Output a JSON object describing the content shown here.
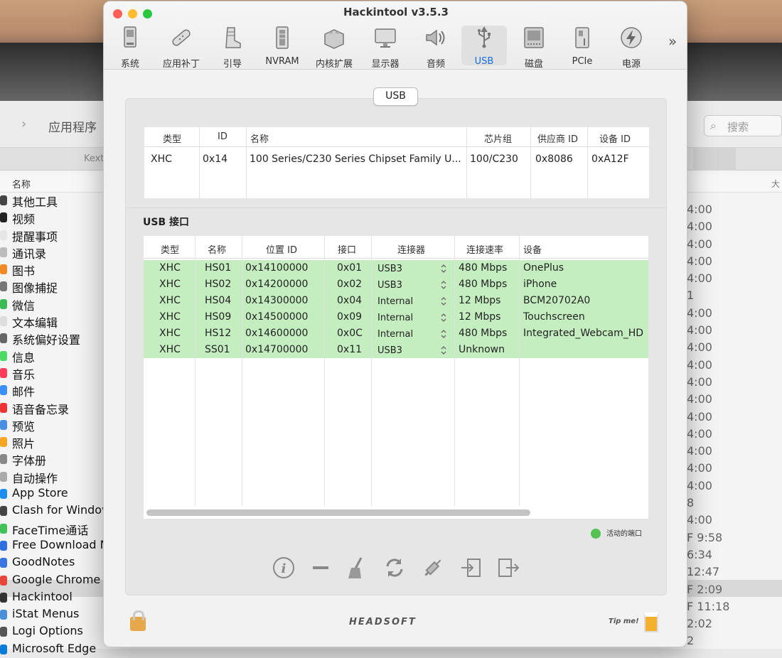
{
  "window": {
    "title": "Hackintool v3.5.3"
  },
  "toolbar": [
    {
      "label": "系统",
      "icon": "computer-icon"
    },
    {
      "label": "应用补丁",
      "icon": "bandage-icon"
    },
    {
      "label": "引导",
      "icon": "boot-icon"
    },
    {
      "label": "NVRAM",
      "icon": "nvram-chip-icon"
    },
    {
      "label": "内核扩展",
      "icon": "lego-brick-icon"
    },
    {
      "label": "显示器",
      "icon": "display-icon"
    },
    {
      "label": "音频",
      "icon": "speaker-icon"
    },
    {
      "label": "USB",
      "icon": "usb-icon"
    },
    {
      "label": "磁盘",
      "icon": "disk-icon"
    },
    {
      "label": "PCIe",
      "icon": "pcie-card-icon"
    },
    {
      "label": "电源",
      "icon": "power-bolt-icon"
    }
  ],
  "toolbar_more": "»",
  "segment": {
    "label": "USB"
  },
  "controller_table": {
    "headers": [
      "类型",
      "ID",
      "名称",
      "芯片组",
      "供应商 ID",
      "设备 ID"
    ],
    "rows": [
      [
        "XHC",
        "0x14",
        "100 Series/C230 Series Chipset Family U...",
        "100/C230",
        "0x8086",
        "0xA12F"
      ]
    ]
  },
  "ports_section": {
    "title": "USB 接口"
  },
  "ports_table": {
    "headers": [
      "类型",
      "名称",
      "位置 ID",
      "接口",
      "连接器",
      "连接速率",
      "设备"
    ],
    "rows": [
      [
        "XHC",
        "HS01",
        "0x14100000",
        "0x01",
        "USB3",
        "480 Mbps",
        "OnePlus"
      ],
      [
        "XHC",
        "HS02",
        "0x14200000",
        "0x02",
        "USB3",
        "480 Mbps",
        "iPhone"
      ],
      [
        "XHC",
        "HS04",
        "0x14300000",
        "0x04",
        "Internal",
        "12 Mbps",
        "BCM20702A0"
      ],
      [
        "XHC",
        "HS09",
        "0x14500000",
        "0x09",
        "Internal",
        "12 Mbps",
        "Touchscreen"
      ],
      [
        "XHC",
        "HS12",
        "0x14600000",
        "0x0C",
        "Internal",
        "480 Mbps",
        "Integrated_Webcam_HD"
      ],
      [
        "XHC",
        "SS01",
        "0x14700000",
        "0x11",
        "USB3",
        "Unknown",
        ""
      ]
    ]
  },
  "legend": {
    "label": "活动的端口",
    "color": "#55c152"
  },
  "bottom_tools": [
    "info-icon",
    "minus-icon",
    "broom-icon",
    "refresh-icon",
    "syringe-icon",
    "import-icon",
    "export-icon"
  ],
  "footer": {
    "brand": "HEADSOFT",
    "tip": "Tip me!"
  },
  "background": {
    "title": "应用程序",
    "search_placeholder": "搜索",
    "tab": "Kext",
    "column_name": "名称",
    "column_size": "大",
    "apps": [
      "其他工具",
      "视频",
      "提醒事项",
      "通讯录",
      "图书",
      "图像捕捉",
      "微信",
      "文本编辑",
      "系统偏好设置",
      "信息",
      "音乐",
      "邮件",
      "语音备忘录",
      "预览",
      "照片",
      "字体册",
      "自动操作",
      "App Store",
      "Clash for Windows",
      "FaceTime通话",
      "Free Download M",
      "GoodNotes",
      "Google Chrome",
      "Hackintool",
      "iStat Menus",
      "Logi Options",
      "Microsoft Edge"
    ],
    "times": [
      "4:00",
      "4:00",
      "4:00",
      "4:00",
      "4:00",
      "1",
      "4:00",
      "4:00",
      "4:00",
      "4:00",
      "4:00",
      "4:00",
      "4:00",
      "4:00",
      "4:00",
      "4:00",
      "4:00",
      "8",
      "4:00",
      "F 9:58",
      "6:34",
      "12:47",
      "F 2:09",
      "F 11:18",
      "2:02",
      "2"
    ]
  }
}
